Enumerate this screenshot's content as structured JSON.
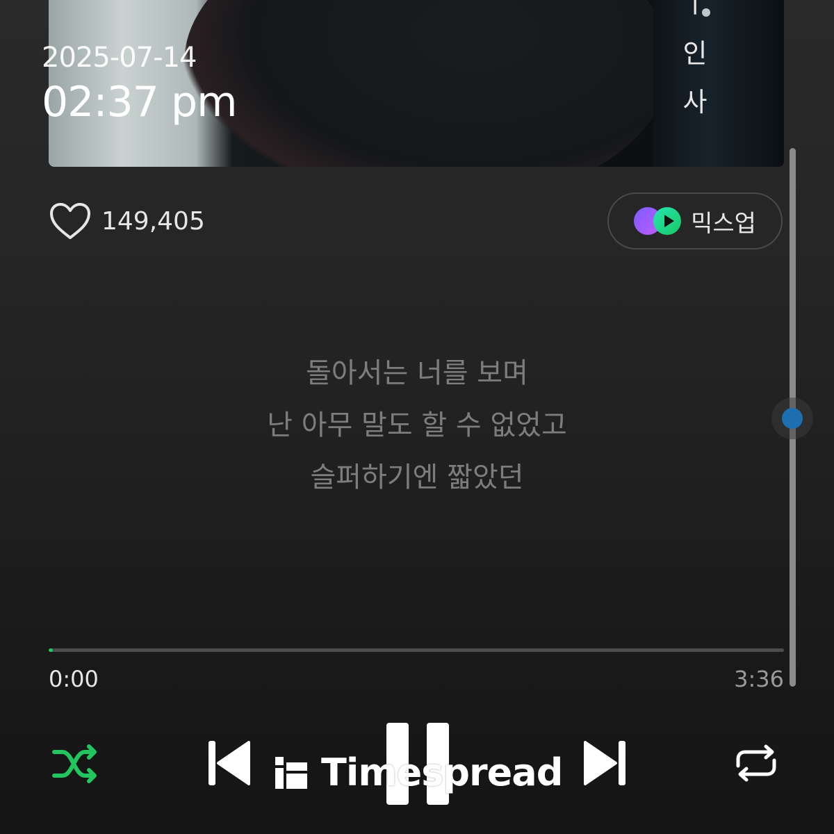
{
  "overlay": {
    "date": "2025-07-14",
    "time": "02:37 pm"
  },
  "album": {
    "vertical_title": [
      "ㅣ",
      "인",
      "사"
    ]
  },
  "like": {
    "icon": "heart-outline-icon",
    "count": "149,405"
  },
  "mixup": {
    "label": "믹스업",
    "icon": "mixup-logo-icon"
  },
  "lyrics": {
    "lines": [
      "돌아서는 너를 보며",
      "난 아무 말도 할 수 없었고",
      "슬퍼하기엔 짧았던"
    ]
  },
  "player": {
    "elapsed": "0:00",
    "total": "3:36",
    "progress": 0.005,
    "accent_color": "#22c55e",
    "controls": {
      "shuffle": "shuffle-icon",
      "previous": "skip-previous-icon",
      "pause": "pause-icon",
      "next": "skip-next-icon",
      "repeat": "repeat-icon"
    }
  },
  "scroll": {
    "position": 0.5
  },
  "watermark": {
    "text": "Timespread"
  }
}
